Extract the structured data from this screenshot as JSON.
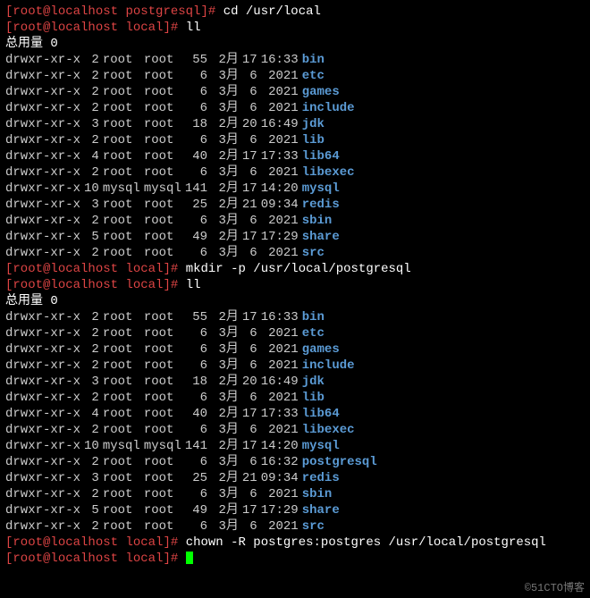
{
  "prompts": {
    "p0": {
      "user": "root",
      "at": "@",
      "host": "localhost",
      "sp": " ",
      "path": "postgresql",
      "hash": "#",
      "cmd": "cd /usr/local"
    },
    "p1": {
      "user": "root",
      "at": "@",
      "host": "localhost",
      "sp": " ",
      "path": "local",
      "hash": "#",
      "cmd": "ll"
    },
    "p2": {
      "user": "root",
      "at": "@",
      "host": "localhost",
      "sp": " ",
      "path": "local",
      "hash": "#",
      "cmd": "mkdir -p /usr/local/postgresql"
    },
    "p3": {
      "user": "root",
      "at": "@",
      "host": "localhost",
      "sp": " ",
      "path": "local",
      "hash": "#",
      "cmd": "ll"
    },
    "p4": {
      "user": "root",
      "at": "@",
      "host": "localhost",
      "sp": " ",
      "path": "local",
      "hash": "#",
      "cmd": "chown -R postgres:postgres /usr/local/postgresql"
    },
    "p5": {
      "user": "root",
      "at": "@",
      "host": "localhost",
      "sp": " ",
      "path": "local",
      "hash": "#",
      "cmd": ""
    },
    "open": "[",
    "close": "]"
  },
  "total1": "总用量 0",
  "total2": "总用量 0",
  "list1": [
    {
      "perm": "drwxr-xr-x",
      "links": " 2",
      "owner": "root ",
      "group": "root ",
      "size": " 55",
      "mon": " 2月",
      "day": "17",
      "time": "16:33",
      "name": "bin"
    },
    {
      "perm": "drwxr-xr-x",
      "links": " 2",
      "owner": "root ",
      "group": "root ",
      "size": "  6",
      "mon": " 3月",
      "day": " 6",
      "time": " 2021",
      "name": "etc"
    },
    {
      "perm": "drwxr-xr-x",
      "links": " 2",
      "owner": "root ",
      "group": "root ",
      "size": "  6",
      "mon": " 3月",
      "day": " 6",
      "time": " 2021",
      "name": "games"
    },
    {
      "perm": "drwxr-xr-x",
      "links": " 2",
      "owner": "root ",
      "group": "root ",
      "size": "  6",
      "mon": " 3月",
      "day": " 6",
      "time": " 2021",
      "name": "include"
    },
    {
      "perm": "drwxr-xr-x",
      "links": " 3",
      "owner": "root ",
      "group": "root ",
      "size": " 18",
      "mon": " 2月",
      "day": "20",
      "time": "16:49",
      "name": "jdk"
    },
    {
      "perm": "drwxr-xr-x",
      "links": " 2",
      "owner": "root ",
      "group": "root ",
      "size": "  6",
      "mon": " 3月",
      "day": " 6",
      "time": " 2021",
      "name": "lib"
    },
    {
      "perm": "drwxr-xr-x",
      "links": " 4",
      "owner": "root ",
      "group": "root ",
      "size": " 40",
      "mon": " 2月",
      "day": "17",
      "time": "17:33",
      "name": "lib64"
    },
    {
      "perm": "drwxr-xr-x",
      "links": " 2",
      "owner": "root ",
      "group": "root ",
      "size": "  6",
      "mon": " 3月",
      "day": " 6",
      "time": " 2021",
      "name": "libexec"
    },
    {
      "perm": "drwxr-xr-x",
      "links": "10",
      "owner": "mysql",
      "group": "mysql",
      "size": "141",
      "mon": " 2月",
      "day": "17",
      "time": "14:20",
      "name": "mysql"
    },
    {
      "perm": "drwxr-xr-x",
      "links": " 3",
      "owner": "root ",
      "group": "root ",
      "size": " 25",
      "mon": " 2月",
      "day": "21",
      "time": "09:34",
      "name": "redis"
    },
    {
      "perm": "drwxr-xr-x",
      "links": " 2",
      "owner": "root ",
      "group": "root ",
      "size": "  6",
      "mon": " 3月",
      "day": " 6",
      "time": " 2021",
      "name": "sbin"
    },
    {
      "perm": "drwxr-xr-x",
      "links": " 5",
      "owner": "root ",
      "group": "root ",
      "size": " 49",
      "mon": " 2月",
      "day": "17",
      "time": "17:29",
      "name": "share"
    },
    {
      "perm": "drwxr-xr-x",
      "links": " 2",
      "owner": "root ",
      "group": "root ",
      "size": "  6",
      "mon": " 3月",
      "day": " 6",
      "time": " 2021",
      "name": "src"
    }
  ],
  "list2": [
    {
      "perm": "drwxr-xr-x",
      "links": " 2",
      "owner": "root ",
      "group": "root ",
      "size": " 55",
      "mon": " 2月",
      "day": "17",
      "time": "16:33",
      "name": "bin"
    },
    {
      "perm": "drwxr-xr-x",
      "links": " 2",
      "owner": "root ",
      "group": "root ",
      "size": "  6",
      "mon": " 3月",
      "day": " 6",
      "time": " 2021",
      "name": "etc"
    },
    {
      "perm": "drwxr-xr-x",
      "links": " 2",
      "owner": "root ",
      "group": "root ",
      "size": "  6",
      "mon": " 3月",
      "day": " 6",
      "time": " 2021",
      "name": "games"
    },
    {
      "perm": "drwxr-xr-x",
      "links": " 2",
      "owner": "root ",
      "group": "root ",
      "size": "  6",
      "mon": " 3月",
      "day": " 6",
      "time": " 2021",
      "name": "include"
    },
    {
      "perm": "drwxr-xr-x",
      "links": " 3",
      "owner": "root ",
      "group": "root ",
      "size": " 18",
      "mon": " 2月",
      "day": "20",
      "time": "16:49",
      "name": "jdk"
    },
    {
      "perm": "drwxr-xr-x",
      "links": " 2",
      "owner": "root ",
      "group": "root ",
      "size": "  6",
      "mon": " 3月",
      "day": " 6",
      "time": " 2021",
      "name": "lib"
    },
    {
      "perm": "drwxr-xr-x",
      "links": " 4",
      "owner": "root ",
      "group": "root ",
      "size": " 40",
      "mon": " 2月",
      "day": "17",
      "time": "17:33",
      "name": "lib64"
    },
    {
      "perm": "drwxr-xr-x",
      "links": " 2",
      "owner": "root ",
      "group": "root ",
      "size": "  6",
      "mon": " 3月",
      "day": " 6",
      "time": " 2021",
      "name": "libexec"
    },
    {
      "perm": "drwxr-xr-x",
      "links": "10",
      "owner": "mysql",
      "group": "mysql",
      "size": "141",
      "mon": " 2月",
      "day": "17",
      "time": "14:20",
      "name": "mysql"
    },
    {
      "perm": "drwxr-xr-x",
      "links": " 2",
      "owner": "root ",
      "group": "root ",
      "size": "  6",
      "mon": " 3月",
      "day": " 6",
      "time": "16:32",
      "name": "postgresql"
    },
    {
      "perm": "drwxr-xr-x",
      "links": " 3",
      "owner": "root ",
      "group": "root ",
      "size": " 25",
      "mon": " 2月",
      "day": "21",
      "time": "09:34",
      "name": "redis"
    },
    {
      "perm": "drwxr-xr-x",
      "links": " 2",
      "owner": "root ",
      "group": "root ",
      "size": "  6",
      "mon": " 3月",
      "day": " 6",
      "time": " 2021",
      "name": "sbin"
    },
    {
      "perm": "drwxr-xr-x",
      "links": " 5",
      "owner": "root ",
      "group": "root ",
      "size": " 49",
      "mon": " 2月",
      "day": "17",
      "time": "17:29",
      "name": "share"
    },
    {
      "perm": "drwxr-xr-x",
      "links": " 2",
      "owner": "root ",
      "group": "root ",
      "size": "  6",
      "mon": " 3月",
      "day": " 6",
      "time": " 2021",
      "name": "src"
    }
  ],
  "watermark": "©51CTO博客"
}
